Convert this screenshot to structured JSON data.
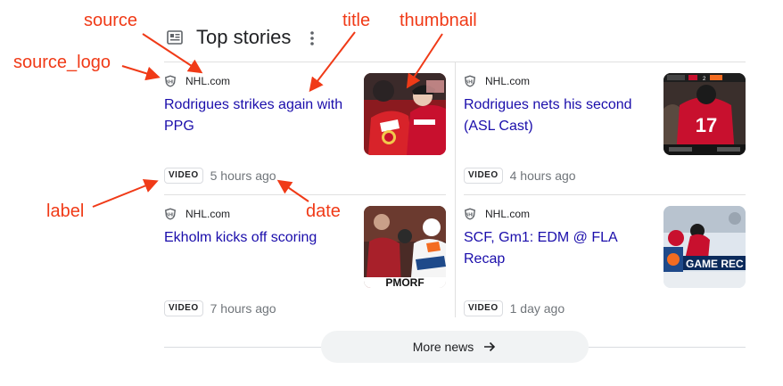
{
  "header": {
    "title": "Top stories",
    "icon": "news-icon",
    "menu_icon": "more-vert-icon"
  },
  "stories": [
    {
      "source": "NHL.com",
      "title": "Rodrigues strikes again with PPG",
      "label": "VIDEO",
      "date": "5 hours ago"
    },
    {
      "source": "NHL.com",
      "title": "Rodrigues nets his second (ASL Cast)",
      "label": "VIDEO",
      "date": "4 hours ago"
    },
    {
      "source": "NHL.com",
      "title": "Ekholm kicks off scoring",
      "label": "VIDEO",
      "date": "7 hours ago"
    },
    {
      "source": "NHL.com",
      "title": "SCF, Gm1: EDM @ FLA Recap",
      "label": "VIDEO",
      "date": "1 day ago"
    }
  ],
  "thumbnails": {
    "t2_score": "2",
    "t2_jersey": "17",
    "t3_text": "PMORF",
    "t4_banner": "GAME REC"
  },
  "more_news": {
    "label": "More news"
  },
  "annotations": {
    "source": "source",
    "title": "title",
    "thumbnail": "thumbnail",
    "source_logo": "source_logo",
    "label": "label",
    "date": "date"
  },
  "colors": {
    "title_link": "#1a0dab",
    "annotation": "#f03a17",
    "date": "#70757a"
  }
}
